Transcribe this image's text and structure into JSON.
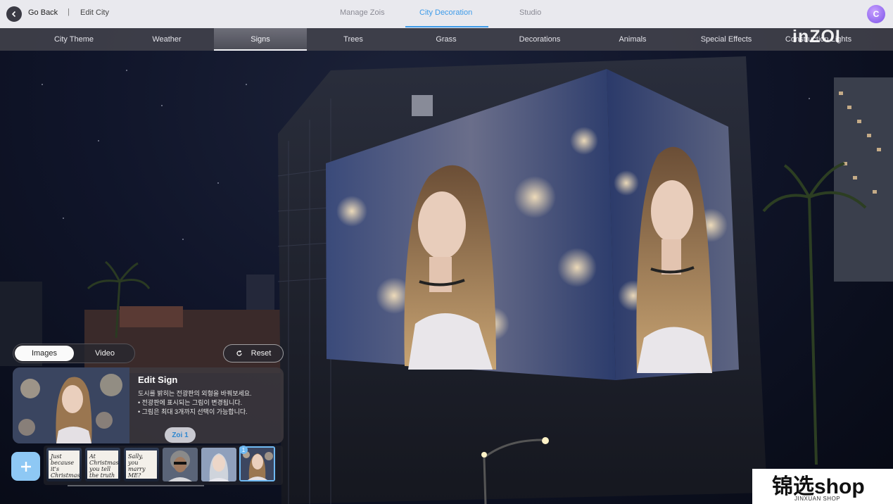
{
  "topbar": {
    "go_back_label": "Go Back",
    "separator": "|",
    "edit_city_label": "Edit City",
    "tabs": [
      {
        "label": "Manage Zois",
        "active": false
      },
      {
        "label": "City Decoration",
        "active": true
      },
      {
        "label": "Studio",
        "active": false
      }
    ],
    "profile_initial": "C",
    "accent_color": "#3d9be9"
  },
  "categories": [
    {
      "label": "City Theme",
      "active": false
    },
    {
      "label": "Weather",
      "active": false
    },
    {
      "label": "Signs",
      "active": true
    },
    {
      "label": "Trees",
      "active": false
    },
    {
      "label": "Grass",
      "active": false
    },
    {
      "label": "Decorations",
      "active": false
    },
    {
      "label": "Animals",
      "active": false
    },
    {
      "label": "Special Effects",
      "active": false
    },
    {
      "label": "Construction Lights",
      "active": false
    }
  ],
  "brand_logo": "inZOI",
  "panel": {
    "media_tabs": [
      {
        "label": "Images",
        "active": true
      },
      {
        "label": "Video",
        "active": false
      }
    ],
    "reset_label": "Reset",
    "card": {
      "title": "Edit Sign",
      "lines": [
        "도시를 밝히는 전광판의 외형을 바꿔보세요.",
        "• 전광판에 표시되는 그림이 변경됩니다.",
        "• 그림은 최대 3개까지 선택이 가능합니다."
      ]
    },
    "zoi_tag": "Zoi 1",
    "thumbnails": [
      {
        "type": "note",
        "text": "Just because it's Christmas..."
      },
      {
        "type": "note",
        "text": "At Christmas you tell the truth"
      },
      {
        "type": "note",
        "text": "Sally, you marry ME?"
      },
      {
        "type": "portrait",
        "text": ""
      },
      {
        "type": "portrait",
        "text": ""
      },
      {
        "type": "portrait",
        "text": "",
        "selected": true
      }
    ],
    "selected_badge": "1"
  },
  "watermark": {
    "main": "锦选shop",
    "sub": "JINXUAN SHOP"
  }
}
